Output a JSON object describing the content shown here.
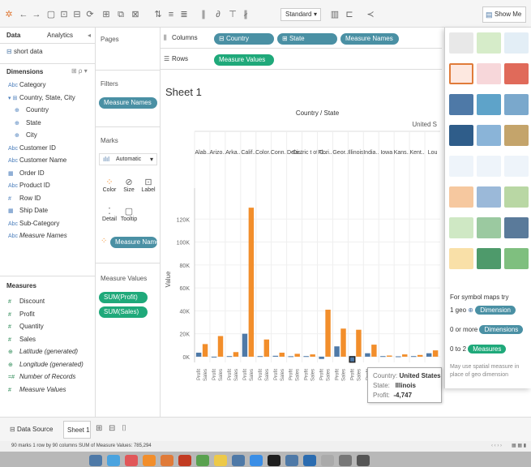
{
  "toolbar": {
    "mark_label_dropdown": "Standard",
    "show_me_label": "Show Me",
    "icons": [
      "tableau-icon",
      "back-icon",
      "forward-icon",
      "save-icon",
      "new-datasource-icon",
      "datasource-icon",
      "undo-icon",
      "new-worksheet-icon",
      "duplicate-icon",
      "clear-icon",
      "swap-icon",
      "sort-asc-icon",
      "sort-desc-icon",
      "highlight-icon",
      "group-icon",
      "label-icon",
      "pin-icon",
      "fit-dropdown-icon",
      "chart-icon",
      "present-icon",
      "share-icon"
    ]
  },
  "left_panel": {
    "tab_data": "Data",
    "tab_analytics": "Analytics",
    "datasource": "short data",
    "dimensions_title": "Dimensions",
    "dimensions": [
      {
        "icon": "Abc",
        "label": "Category"
      },
      {
        "icon": "▾ ⊞",
        "label": "Country, State, City"
      },
      {
        "icon": "⊕",
        "label": "Country"
      },
      {
        "icon": "⊕",
        "label": "State"
      },
      {
        "icon": "⊕",
        "label": "City"
      },
      {
        "icon": "Abc",
        "label": "Customer ID"
      },
      {
        "icon": "Abc",
        "label": "Customer Name"
      },
      {
        "icon": "▦",
        "label": "Order ID"
      },
      {
        "icon": "Abc",
        "label": "Product ID"
      },
      {
        "icon": "#",
        "label": "Row ID"
      },
      {
        "icon": "▦",
        "label": "Ship Date"
      },
      {
        "icon": "Abc",
        "label": "Sub-Category"
      },
      {
        "icon": "Abc",
        "label": "Measure Names"
      }
    ],
    "measures_title": "Measures",
    "measures": [
      {
        "icon": "#",
        "label": "Discount"
      },
      {
        "icon": "#",
        "label": "Profit"
      },
      {
        "icon": "#",
        "label": "Quantity"
      },
      {
        "icon": "#",
        "label": "Sales"
      },
      {
        "icon": "⊕",
        "label": "Latitude (generated)"
      },
      {
        "icon": "⊕",
        "label": "Longitude (generated)"
      },
      {
        "icon": "=#",
        "label": "Number of Records"
      },
      {
        "icon": "#",
        "label": "Measure Values"
      }
    ]
  },
  "mid_panel": {
    "pages": "Pages",
    "filters": "Filters",
    "filter_pill": "Measure Names",
    "marks": "Marks",
    "mark_type": "Automatic",
    "mark_buttons": [
      "Color",
      "Size",
      "Label",
      "Detail",
      "Tooltip"
    ],
    "color_pill": "Measure Names",
    "measure_values_title": "Measure Values",
    "mv_pills": [
      "SUM(Profit)",
      "SUM(Sales)"
    ]
  },
  "shelves": {
    "columns_label": "Columns",
    "rows_label": "Rows",
    "columns_pills": [
      "Country",
      "State",
      "Measure Names"
    ],
    "rows_pill": "Measure Values"
  },
  "sheet": {
    "title": "Sheet 1",
    "header_top": "Country / State",
    "header_country": "United S",
    "states": [
      "Alab..",
      "Arizo..",
      "Arka..",
      "Calif..",
      "Color..",
      "Conn..",
      "Dela..",
      "Distric t of C..",
      "Flori..",
      "Geor..",
      "Illinois",
      "India..",
      "Iowa",
      "Kans..",
      "Kent..",
      "Lou"
    ],
    "y_axis_label": "Value",
    "y_ticks": [
      "0K",
      "20K",
      "40K",
      "60K",
      "80K",
      "100K",
      "120K"
    ],
    "measure_names": [
      "Profit",
      "Sales"
    ]
  },
  "chart_data": {
    "type": "bar",
    "title": "Sheet 1",
    "ylabel": "Value",
    "ylim": [
      -5000,
      140000
    ],
    "categories": [
      "Alab..",
      "Arizo..",
      "Arka..",
      "Calif..",
      "Color..",
      "Conn..",
      "Dela..",
      "Distric t of C..",
      "Flori..",
      "Geor..",
      "Illinois",
      "India..",
      "Iowa",
      "Kans..",
      "Kent..",
      "Lou"
    ],
    "series": [
      {
        "name": "Profit",
        "values": [
          3500,
          -300,
          500,
          20000,
          500,
          800,
          400,
          500,
          -2000,
          9000,
          -4747,
          3000,
          500,
          300,
          500,
          3000
        ]
      },
      {
        "name": "Sales",
        "values": [
          11000,
          18000,
          4000,
          130000,
          15000,
          3500,
          2500,
          2000,
          41000,
          24500,
          23500,
          10500,
          1000,
          2000,
          1500,
          5500
        ]
      }
    ],
    "colors": {
      "Profit": "#4e79a7",
      "Sales": "#f28e2b"
    }
  },
  "tooltip": {
    "country_key": "Country:",
    "country_val": "United States",
    "state_key": "State:",
    "state_val": "Illinois",
    "profit_key": "Profit:",
    "profit_val": "-4,747"
  },
  "show_me": {
    "hint_title": "For symbol maps try",
    "hint1_prefix": "1 geo",
    "hint1_pill": "Dimension",
    "hint2_prefix": "0 or more",
    "hint2_pill": "Dimensions",
    "hint3_prefix": "0 to 2",
    "hint3_pill": "Measures",
    "note": "May use spatial measure in place of geo dimension"
  },
  "tabs": {
    "data_source": "Data Source",
    "sheet1": "Sheet 1"
  },
  "status": {
    "text": "90 marks   1 row by 90 columns   SUM of Measure Values: 785,294"
  }
}
